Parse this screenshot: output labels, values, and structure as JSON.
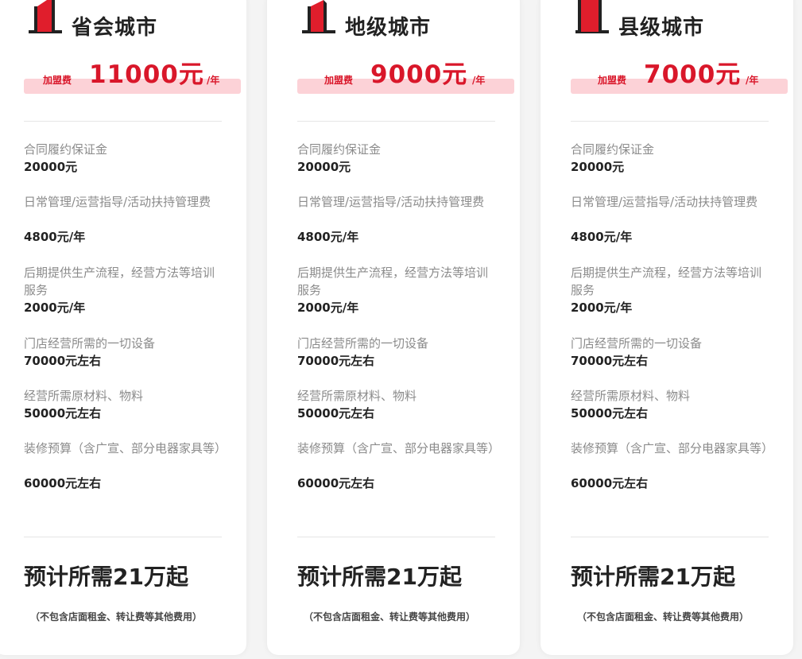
{
  "colors": {
    "accent": "#d9172a",
    "accent_light": "#fcd2d7",
    "text_dark": "#222222",
    "text_muted": "#8b8b8b"
  },
  "fee": {
    "label": "加盟费",
    "unit": "/年"
  },
  "items": [
    {
      "label": "合同履约保证金",
      "value": "20000元"
    },
    {
      "label": "日常管理/运营指导/活动扶持管理费",
      "value": "4800元/年"
    },
    {
      "label": "后期提供生产流程，经营方法等培训服务",
      "value": "2000元/年"
    },
    {
      "label": "门店经营所需的一切设备",
      "value": "70000元左右"
    },
    {
      "label": "经营所需原材料、物料",
      "value": "50000元左右"
    },
    {
      "label": "装修预算（含广宣、部分电器家具等）",
      "value": "60000元左右"
    }
  ],
  "total": "预计所需21万起",
  "note": "（不包含店面租金、转让费等其他费用）",
  "plans": [
    {
      "tier": "省会城市",
      "icon": "tall-building-icon",
      "price": "11000元"
    },
    {
      "tier": "地级城市",
      "icon": "medium-building-icon",
      "price": "9000元"
    },
    {
      "tier": "县级城市",
      "icon": "small-building-icon",
      "price": "7000元"
    }
  ]
}
